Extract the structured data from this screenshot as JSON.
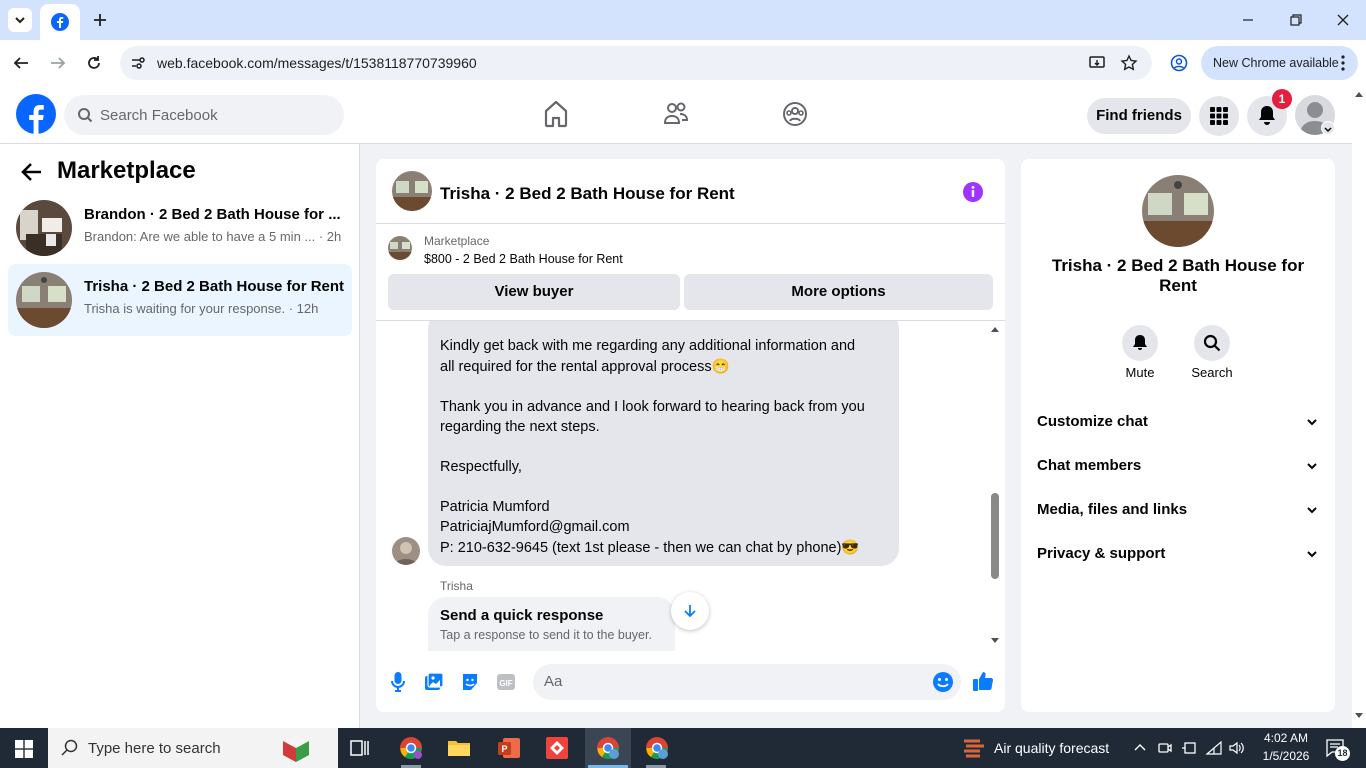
{
  "browser": {
    "url": "web.facebook.com/messages/t/1538118770739960",
    "update_label": "New Chrome available"
  },
  "fb_header": {
    "search_placeholder": "Search Facebook",
    "find_friends": "Find friends",
    "notification_count": "1"
  },
  "left_panel": {
    "title": "Marketplace",
    "conversations": [
      {
        "title": "Brandon · 2 Bed 2 Bath House for ...",
        "snippet": "Brandon: Are we able to have a 5 min ... · 2h"
      },
      {
        "title": "Trisha · 2 Bed 2 Bath House for Rent",
        "snippet": "Trisha is waiting for your response. · 12h"
      }
    ]
  },
  "chat": {
    "title": "Trisha · 2 Bed 2 Bath House for Rent",
    "marketplace_label": "Marketplace",
    "listing": "$800 - 2 Bed 2 Bath House for Rent",
    "view_buyer": "View buyer",
    "more_options": "More options",
    "message_lines": [
      "Kindly get back with me regarding any additional information and",
      "all required for the rental approval process😁",
      "",
      "Thank you in advance and I look forward to hearing back from you",
      "regarding the next steps.",
      "",
      "Respectfully,",
      "",
      "Patricia Mumford",
      "PatriciajMumford@gmail.com",
      "P: 210-632-9645 (text 1st please - then we can chat by phone)😎"
    ],
    "sender_label": "Trisha",
    "quick_response_title": "Send a quick response",
    "quick_response_sub": "Tap a response to send it to the buyer.",
    "composer_placeholder": "Aa"
  },
  "right_panel": {
    "name": "Trisha · 2 Bed 2 Bath House for Rent",
    "mute_label": "Mute",
    "search_label": "Search",
    "sections": [
      "Customize chat",
      "Chat members",
      "Media, files and links",
      "Privacy & support"
    ]
  },
  "taskbar": {
    "search_placeholder": "Type here to search",
    "weather": "Air quality forecast",
    "time": "4:02 AM",
    "date": "1/5/2026",
    "notif_count": "18"
  },
  "colors": {
    "fb_blue": "#0866ff",
    "accent_purple": "#a033ff",
    "messenger_blue": "#0a7cff"
  }
}
